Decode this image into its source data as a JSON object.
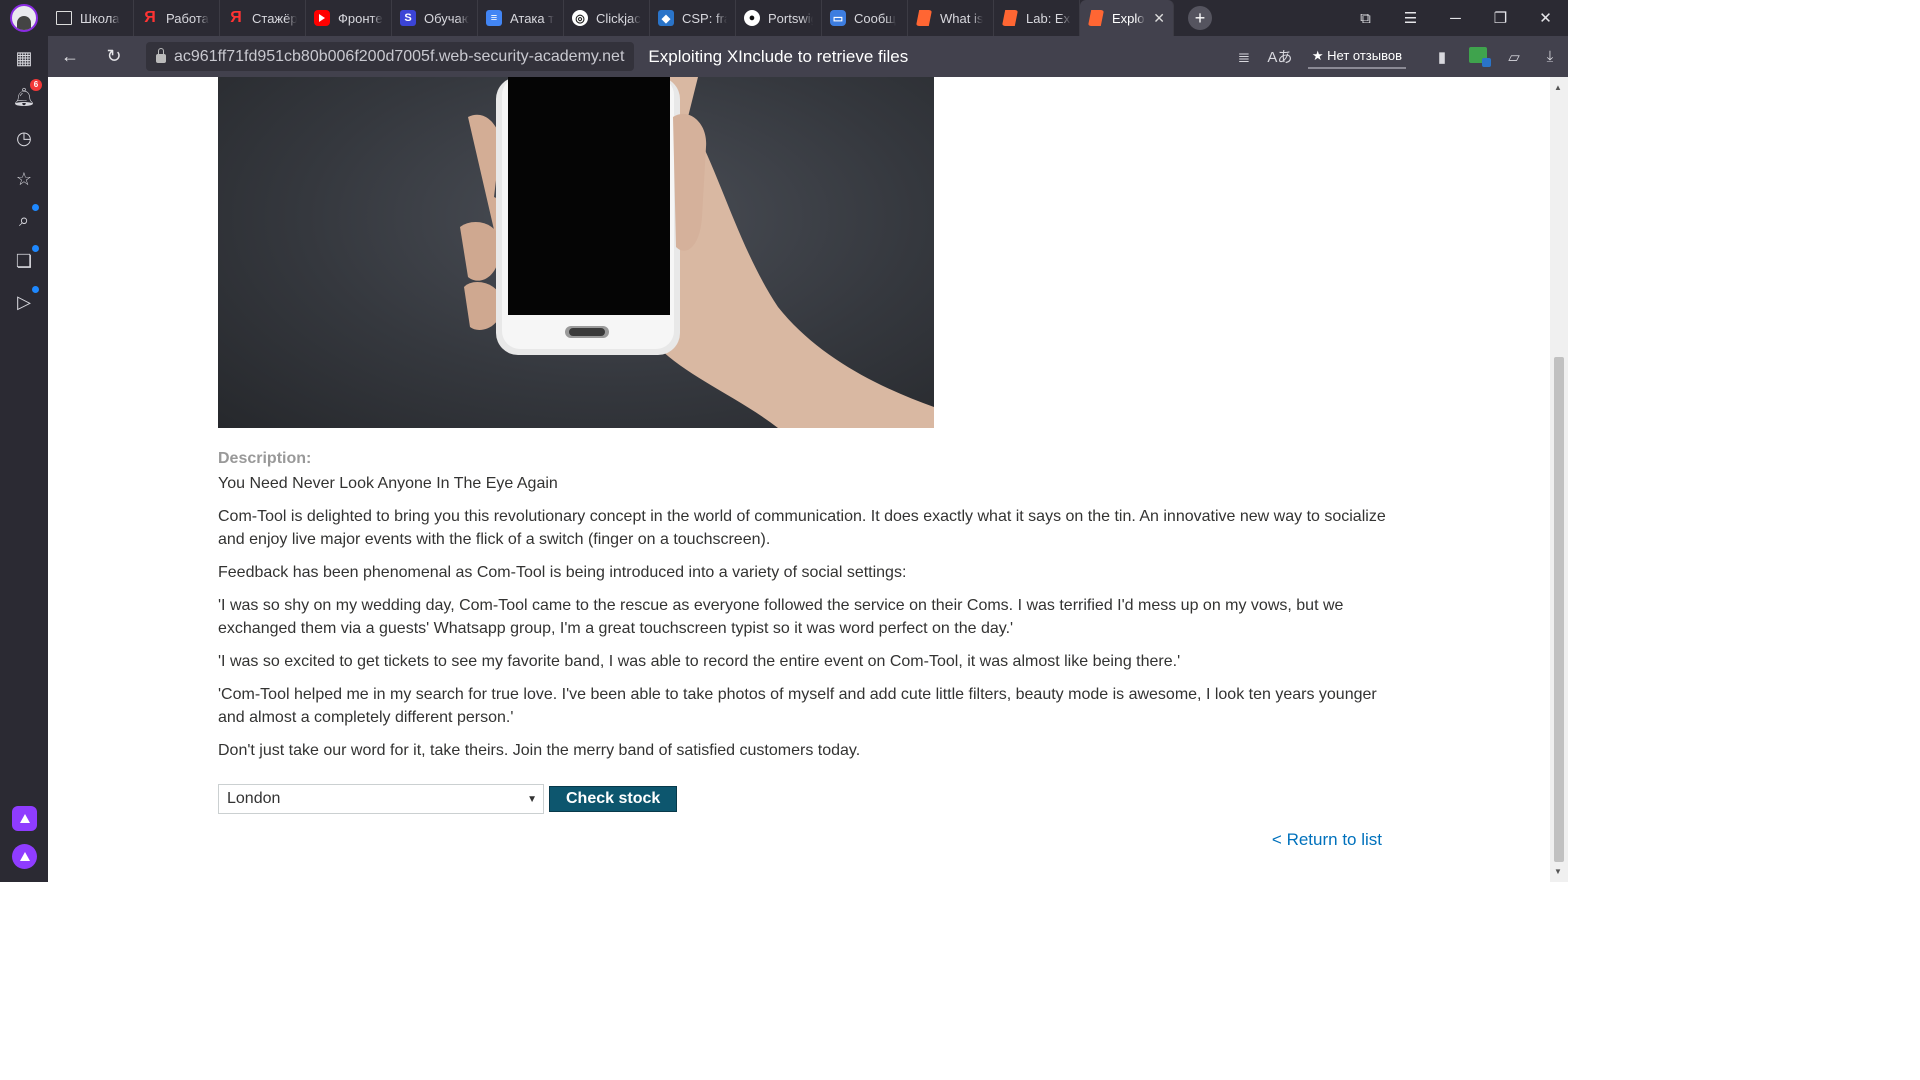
{
  "browser": {
    "tabs": [
      {
        "label": "Школа",
        "icon": "page-icon"
      },
      {
        "label": "Работа",
        "icon": "yandex-icon"
      },
      {
        "label": "Стажёр",
        "icon": "yandex-icon"
      },
      {
        "label": "Фронте",
        "icon": "youtube-icon"
      },
      {
        "label": "Обучаю",
        "icon": "s-app-icon"
      },
      {
        "label": "Атака т",
        "icon": "docs-icon"
      },
      {
        "label": "Clickjack",
        "icon": "round-icon"
      },
      {
        "label": "CSP: fra",
        "icon": "csp-icon"
      },
      {
        "label": "Portswig",
        "icon": "github-icon"
      },
      {
        "label": "Сообщ",
        "icon": "message-icon"
      },
      {
        "label": "What is",
        "icon": "portswigger-icon"
      },
      {
        "label": "Lab: Exp",
        "icon": "portswigger-icon"
      },
      {
        "label": "Explo",
        "icon": "portswigger-icon",
        "active": true
      }
    ],
    "url": "ac961ff71fd951cb80b006f200d7005f.web-security-academy.net",
    "page_title": "Exploiting XInclude to retrieve files",
    "reviews_label": "Нет отзывов",
    "notification_count": "6"
  },
  "product": {
    "description_label": "Description:",
    "tagline": "You Need Never Look Anyone In The Eye Again",
    "paragraphs": [
      "Com-Tool is delighted to bring you this revolutionary concept in the world of communication. It does exactly what it says on the tin. An innovative new way to socialize and enjoy live major events with the flick of a switch (finger on a touchscreen).",
      "Feedback has been phenomenal as Com-Tool is being introduced into a variety of social settings:",
      "'I was so shy on my wedding day, Com-Tool came to the rescue as everyone followed the service on their Coms. I was terrified I'd mess up on my vows, but we exchanged them via a guests' Whatsapp group, I'm a great touchscreen typist so it was word perfect on the day.'",
      "'I was so excited to get tickets to see my favorite band, I was able to record the entire event on Com-Tool, it was almost like being there.'",
      "'Com-Tool helped me in my search for true love. I've been able to take photos of myself and add cute little filters, beauty mode is awesome, I look ten years younger and almost a completely different person.'",
      "Don't just take our word for it, take theirs. Join the merry band of satisfied customers today."
    ],
    "store_selected": "London",
    "check_stock_label": "Check stock",
    "return_link": "< Return to list"
  },
  "colors": {
    "button_bg": "#0d566e",
    "link": "#0071bc",
    "label_gray": "#999999"
  }
}
